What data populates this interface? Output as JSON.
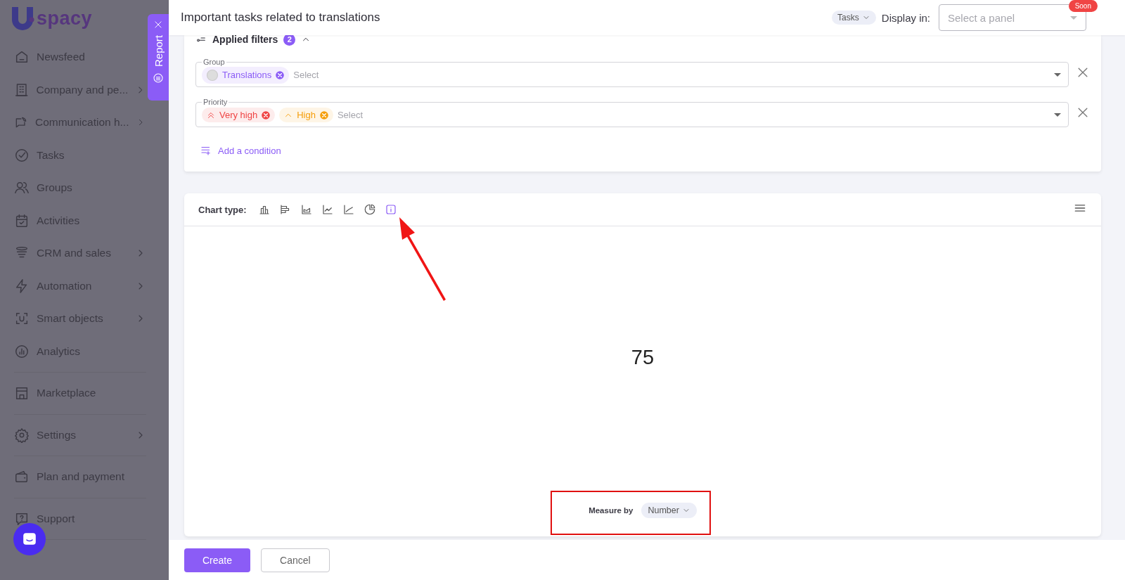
{
  "sidebar": {
    "logo_text": "spacy",
    "sections": [
      {
        "items": [
          {
            "label": "Newsfeed",
            "kind": "home",
            "has_submenu": false
          },
          {
            "label": "Company and pe...",
            "kind": "building",
            "has_submenu": true
          },
          {
            "label": "Communication h...",
            "kind": "chat",
            "has_submenu": true
          },
          {
            "label": "Tasks",
            "kind": "check",
            "has_submenu": false
          },
          {
            "label": "Groups",
            "kind": "people",
            "has_submenu": false
          },
          {
            "label": "Activities",
            "kind": "calendar",
            "has_submenu": false
          },
          {
            "label": "CRM and sales",
            "kind": "funnel",
            "has_submenu": true
          },
          {
            "label": "Automation",
            "kind": "bolt",
            "has_submenu": true
          },
          {
            "label": "Smart objects",
            "kind": "scan",
            "has_submenu": true
          },
          {
            "label": "Analytics",
            "kind": "analytics",
            "has_submenu": false
          }
        ]
      },
      {
        "items": [
          {
            "label": "Marketplace",
            "kind": "store",
            "has_submenu": false
          }
        ]
      },
      {
        "items": [
          {
            "label": "Settings",
            "kind": "gear",
            "has_submenu": true
          }
        ]
      },
      {
        "items": [
          {
            "label": "Plan and payment",
            "kind": "wallet",
            "has_submenu": false
          }
        ]
      },
      {
        "items": [
          {
            "label": "Support",
            "kind": "help",
            "has_submenu": false
          }
        ]
      }
    ]
  },
  "report_tab": {
    "label": "Report"
  },
  "header": {
    "title": "Important tasks related to translations",
    "entity": "Tasks",
    "display_label": "Display in:",
    "panel_select": {
      "placeholder": "Select a panel",
      "badge": "Soon"
    }
  },
  "filters": {
    "title": "Applied filters",
    "count": "2",
    "conditions": [
      {
        "label": "Group",
        "tags": [
          {
            "text": "Translations",
            "kind": "group",
            "color": "#8b5cf6"
          }
        ],
        "placeholder": "Select"
      },
      {
        "label": "Priority",
        "tags": [
          {
            "text": "Very high",
            "kind": "very-high",
            "color": "#ef4444"
          },
          {
            "text": "High",
            "kind": "high",
            "color": "#f59e0b"
          }
        ],
        "placeholder": "Select"
      }
    ],
    "add_label": "Add a condition"
  },
  "chart": {
    "label": "Chart type:",
    "types": [
      {
        "kind": "column",
        "selected": false
      },
      {
        "kind": "bar",
        "selected": false
      },
      {
        "kind": "area",
        "selected": false
      },
      {
        "kind": "line",
        "selected": false
      },
      {
        "kind": "trend",
        "selected": false
      },
      {
        "kind": "pie",
        "selected": false
      },
      {
        "kind": "number",
        "selected": true
      }
    ],
    "value": "75",
    "measure_label": "Measure by",
    "measure_value": "Number"
  },
  "footer": {
    "buttons": [
      {
        "label": "Create",
        "kind": "primary"
      },
      {
        "label": "Cancel",
        "kind": "secondary"
      }
    ]
  }
}
